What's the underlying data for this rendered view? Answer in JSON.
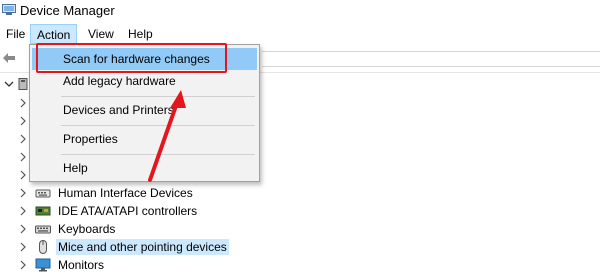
{
  "window": {
    "title": "Device Manager"
  },
  "menu": {
    "file": "File",
    "action": "Action",
    "view": "View",
    "help": "Help"
  },
  "action_menu": {
    "items": [
      {
        "label": "Scan for hardware changes",
        "highlighted": true
      },
      {
        "label": "Add legacy hardware"
      },
      {
        "label": "Devices and Printers"
      },
      {
        "label": "Properties"
      },
      {
        "label": "Help"
      }
    ]
  },
  "tree": {
    "items": [
      {
        "label": "Human Interface Devices",
        "icon": "hid-icon"
      },
      {
        "label": "IDE ATA/ATAPI controllers",
        "icon": "ide-controller-icon"
      },
      {
        "label": "Keyboards",
        "icon": "keyboard-icon"
      },
      {
        "label": "Mice and other pointing devices",
        "icon": "mouse-icon",
        "selected": true
      },
      {
        "label": "Monitors",
        "icon": "monitor-icon"
      }
    ]
  },
  "colors": {
    "highlight": "#91c9f7",
    "selection": "#cce8ff",
    "annotation": "#e3161e"
  }
}
